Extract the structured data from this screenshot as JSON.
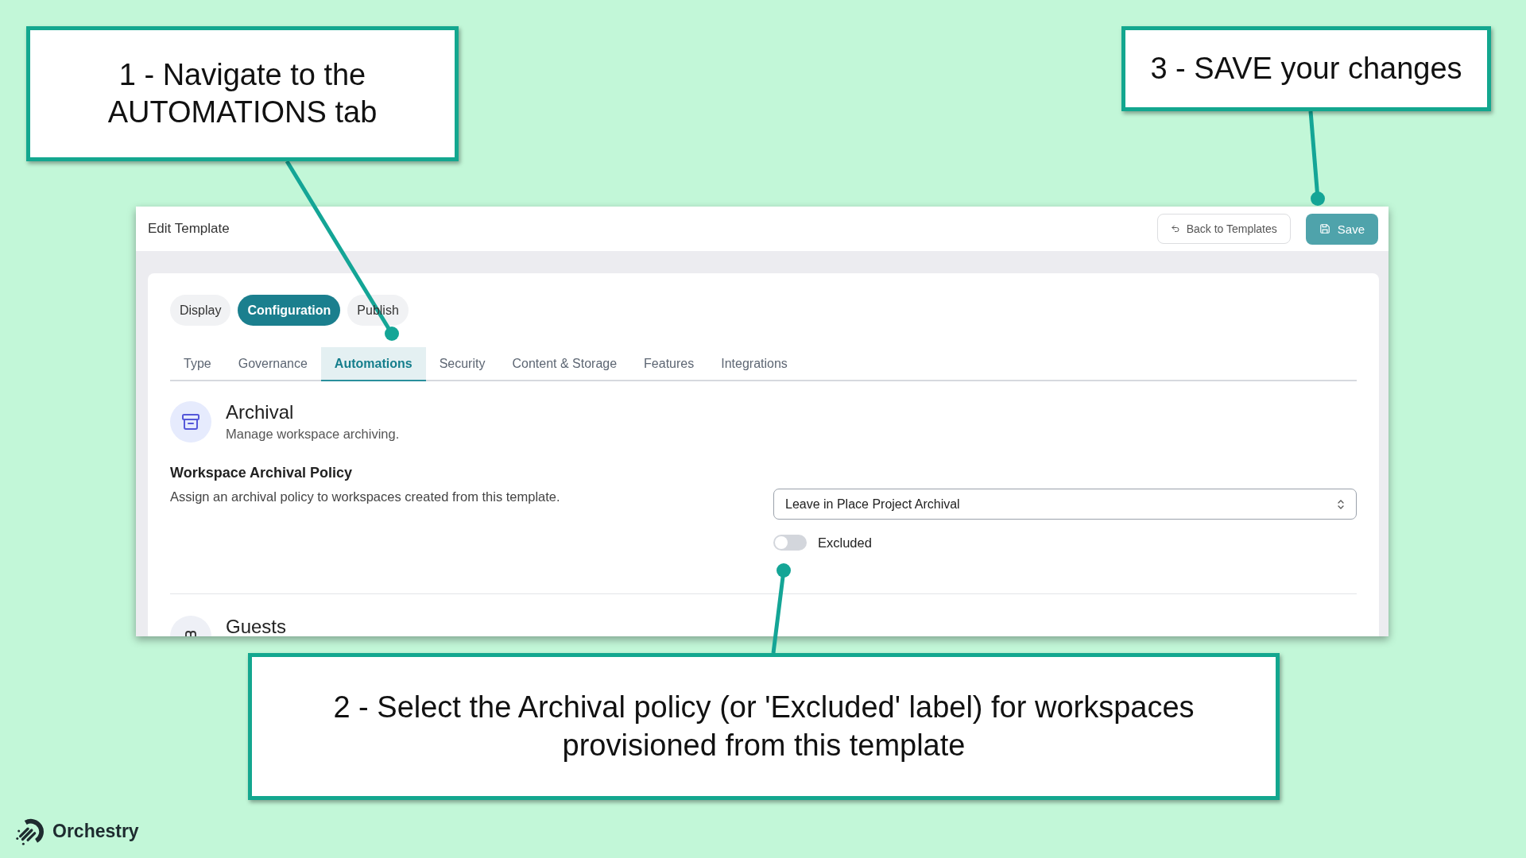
{
  "callouts": [
    {
      "text": "1 - Navigate to the AUTOMATIONS tab"
    },
    {
      "text": "3 - SAVE your changes"
    },
    {
      "text": "2 - Select the Archival policy (or 'Excluded' label) for workspaces provisioned from this template"
    }
  ],
  "app": {
    "title": "Edit Template",
    "header_buttons": [
      {
        "label": "Back to Templates",
        "kind": "secondary"
      },
      {
        "label": "Save",
        "kind": "primary"
      }
    ],
    "mode_tabs": [
      {
        "label": "Display",
        "selected": false
      },
      {
        "label": "Configuration",
        "selected": true
      },
      {
        "label": "Publish",
        "selected": false
      }
    ],
    "section_tabs": [
      {
        "label": "Type",
        "selected": false
      },
      {
        "label": "Governance",
        "selected": false
      },
      {
        "label": "Automations",
        "selected": true
      },
      {
        "label": "Security",
        "selected": false
      },
      {
        "label": "Content & Storage",
        "selected": false
      },
      {
        "label": "Features",
        "selected": false
      },
      {
        "label": "Integrations",
        "selected": false
      }
    ],
    "sections": [
      {
        "title": "Archival",
        "subtitle": "Manage workspace archiving.",
        "setting": {
          "label": "Workspace Archival Policy",
          "description": "Assign an archival policy to workspaces created from this template.",
          "select": {
            "value": "Leave in Place Project Archival"
          },
          "toggle": {
            "label": "Excluded",
            "on": false
          }
        }
      },
      {
        "title": "Guests"
      }
    ]
  },
  "brand": {
    "name": "Orchestry"
  }
}
